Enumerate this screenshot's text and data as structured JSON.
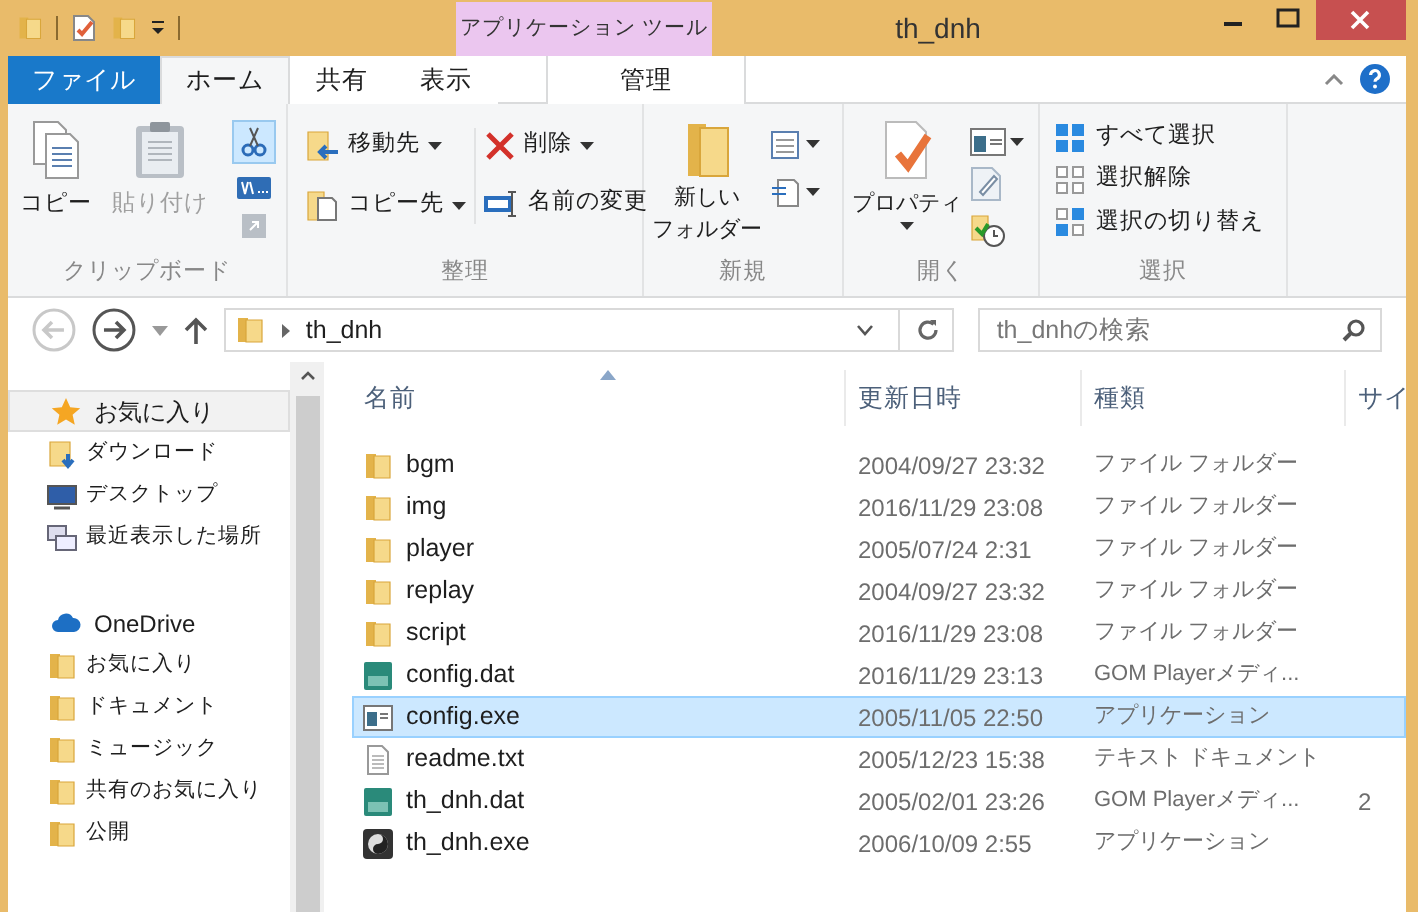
{
  "title_bar": {
    "context_label": "アプリケーション ツール",
    "title": "th_dnh"
  },
  "ribbon_tabs": [
    {
      "label": "ファイル",
      "kind": "file",
      "selected": false
    },
    {
      "label": "ホーム",
      "kind": "normal",
      "selected": true
    },
    {
      "label": "共有",
      "kind": "normal",
      "selected": false
    },
    {
      "label": "表示",
      "kind": "normal",
      "selected": false
    },
    {
      "label": "管理",
      "kind": "context",
      "selected": false
    }
  ],
  "ribbon": {
    "clipboard": {
      "label": "クリップボード",
      "copy": {
        "label": "コピー",
        "disabled": false
      },
      "paste": {
        "label": "貼り付け",
        "disabled": true
      }
    },
    "organize": {
      "label": "整理",
      "move_to": "移動先",
      "copy_to": "コピー先",
      "delete": "削除",
      "rename": "名前の変更"
    },
    "new": {
      "label": "新規",
      "new_folder": [
        "新しい",
        "フォルダー"
      ]
    },
    "open": {
      "label": "開く",
      "properties": "プロパティ"
    },
    "select": {
      "label": "選択",
      "items": [
        "すべて選択",
        "選択解除",
        "選択の切り替え"
      ]
    }
  },
  "address": {
    "path": "th_dnh",
    "search_placeholder": "th_dnhの検索"
  },
  "navigation": [
    {
      "label": "お気に入り",
      "kind": "favorites",
      "selected": true,
      "children": [
        {
          "label": "ダウンロード",
          "kind": "downloads",
          "selected": false
        },
        {
          "label": "デスクトップ",
          "kind": "desktop",
          "selected": false
        },
        {
          "label": "最近表示した場所",
          "kind": "recent",
          "selected": false
        }
      ]
    },
    {
      "label": "OneDrive",
      "kind": "cloud",
      "selected": false,
      "children": [
        {
          "label": "お気に入り",
          "kind": "folder",
          "selected": false
        },
        {
          "label": "ドキュメント",
          "kind": "folder",
          "selected": false
        },
        {
          "label": "ミュージック",
          "kind": "folder",
          "selected": false
        },
        {
          "label": "共有のお気に入り",
          "kind": "folder",
          "selected": false
        },
        {
          "label": "公開",
          "kind": "folder",
          "selected": false
        }
      ]
    }
  ],
  "file_list": {
    "columns": [
      "名前",
      "更新日時",
      "種類",
      "サイ"
    ],
    "rows": [
      {
        "name": "bgm",
        "kind": "folder",
        "date": "2004/09/27 23:32",
        "type": "ファイル フォルダー",
        "selected": false
      },
      {
        "name": "img",
        "kind": "folder",
        "date": "2016/11/29 23:08",
        "type": "ファイル フォルダー",
        "selected": false
      },
      {
        "name": "player",
        "kind": "folder",
        "date": "2005/07/24 2:31",
        "type": "ファイル フォルダー",
        "selected": false
      },
      {
        "name": "replay",
        "kind": "folder",
        "date": "2004/09/27 23:32",
        "type": "ファイル フォルダー",
        "selected": false
      },
      {
        "name": "script",
        "kind": "folder",
        "date": "2016/11/29 23:08",
        "type": "ファイル フォルダー",
        "selected": false
      },
      {
        "name": "config.dat",
        "kind": "dat",
        "date": "2016/11/29 23:13",
        "type": "GOM Playerメディ...",
        "selected": false
      },
      {
        "name": "config.exe",
        "kind": "app",
        "date": "2005/11/05 22:50",
        "type": "アプリケーション",
        "selected": true
      },
      {
        "name": "readme.txt",
        "kind": "text",
        "date": "2005/12/23 15:38",
        "type": "テキスト ドキュメント",
        "selected": false
      },
      {
        "name": "th_dnh.dat",
        "kind": "dat",
        "date": "2005/02/01 23:26",
        "type": "GOM Playerメディ...",
        "size": "2",
        "selected": false
      },
      {
        "name": "th_dnh.exe",
        "kind": "yinyang",
        "date": "2006/10/09 2:55",
        "type": "アプリケーション",
        "selected": false
      }
    ]
  }
}
